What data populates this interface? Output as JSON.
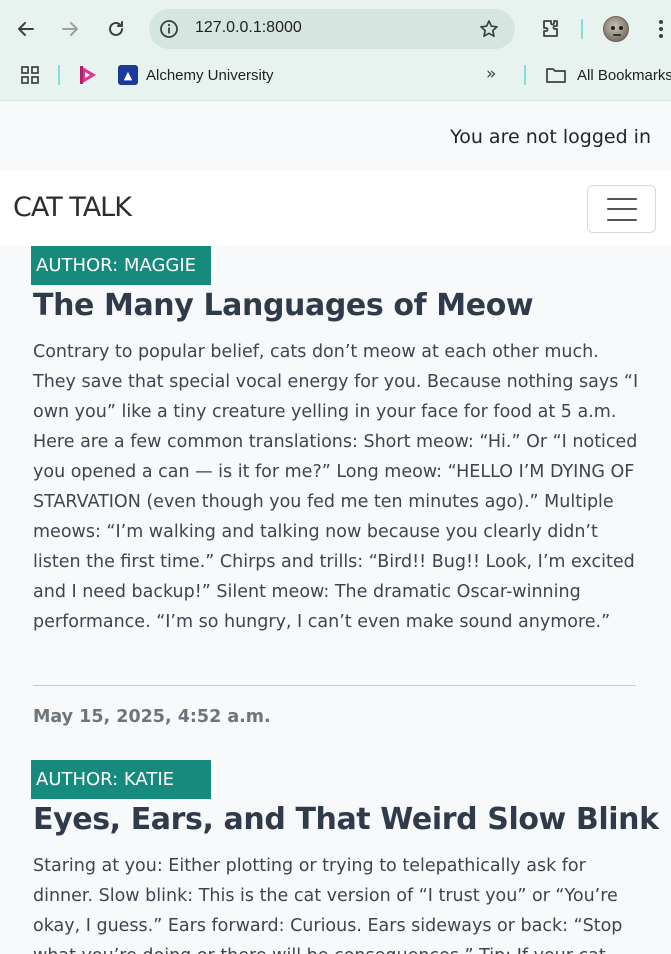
{
  "browser": {
    "url": "127.0.0.1:8000",
    "bookmarks": [
      {
        "label": "Alchemy University",
        "icon": "alchemy-logo-icon"
      }
    ],
    "all_bookmarks_label": "All Bookmarks",
    "overflow_label": "»"
  },
  "page": {
    "status_text": "You are not logged in",
    "brand": "CAT TALK",
    "accent_color": "#178a7e"
  },
  "posts": [
    {
      "author_badge": "AUTHOR: MAGGIE",
      "title": "The Many Languages of Meow",
      "body": "Contrary to popular belief, cats don’t meow at each other much. They save that special vocal energy for you. Because nothing says “I own you” like a tiny creature yelling in your face for food at 5 a.m. Here are a few common translations: Short meow: “Hi.” Or “I noticed you opened a can — is it for me?” Long meow: “HELLO I’M DYING OF STARVATION (even though you fed me ten minutes ago).” Multiple meows: “I’m walking and talking now because you clearly didn’t listen the first time.” Chirps and trills: “Bird!! Bug!! Look, I’m excited and I need backup!” Silent meow: The dramatic Oscar-winning performance. “I’m so hungry, I can’t even make sound anymore.”",
      "date": "May 15, 2025, 4:52 a.m."
    },
    {
      "author_badge": "AUTHOR: KATIE",
      "title": "Eyes, Ears, and That Weird Slow Blink",
      "body": "Staring at you: Either plotting or trying to telepathically ask for dinner. Slow blink: This is the cat version of “I trust you” or “You’re okay, I guess.” Ears forward: Curious. Ears sideways or back: “Stop what you’re doing or there will be consequences.” Tip: If your cat"
    }
  ]
}
